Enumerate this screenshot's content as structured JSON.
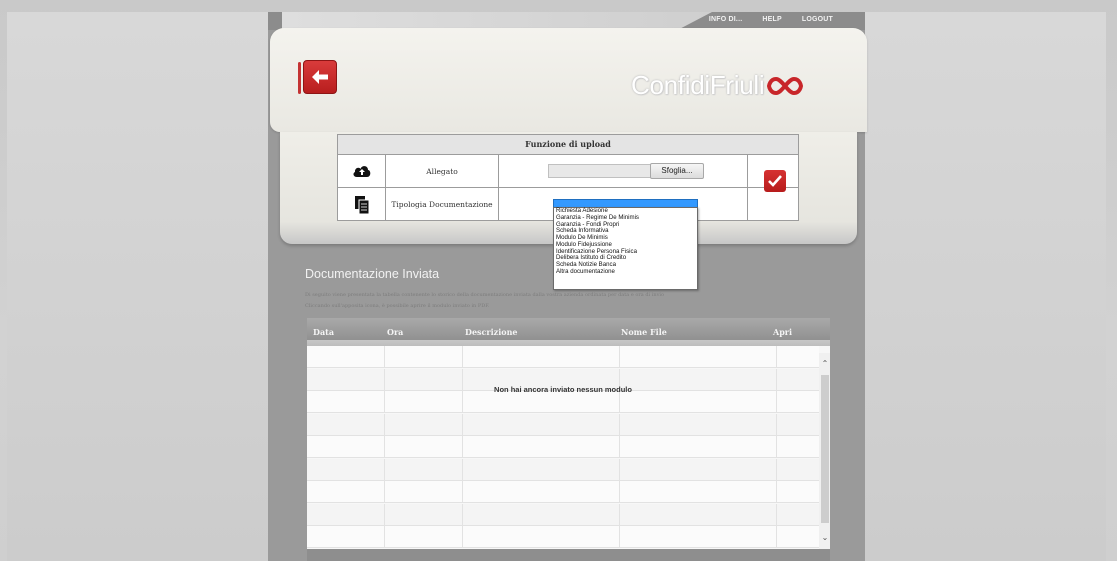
{
  "topnav": {
    "links": [
      "INFO DI...",
      "HELP",
      "LOGOUT"
    ]
  },
  "header": {
    "back_icon": "arrow-left-icon",
    "logo_text": "ConfidiFriuli",
    "logo_icon": "infinity-loop-icon",
    "brand_color": "#c8262a"
  },
  "upload": {
    "title": "Funzione di upload",
    "rows": [
      {
        "icon": "cloud-upload-icon",
        "label": "Allegato",
        "button": "Sfoglia..."
      },
      {
        "icon": "document-copy-icon",
        "label": "Tipologia Documentazione"
      }
    ],
    "confirm_icon": "checkmark-icon",
    "dropdown_options": [
      "Richiesta Adesione",
      "Garanzia - Regime De Minimis",
      "Garanzia - Fondi Propri",
      "Scheda Informativa",
      "Modulo De Minimis",
      "Modulo Fidejussione",
      "Identificazione Persona Fisica",
      "Delibera Istituto di Credito",
      "Scheda Notizie Banca",
      "Altra documentazione"
    ]
  },
  "documents": {
    "title": "Documentazione Inviata",
    "desc_line1": "Di seguito viene presentata la tabella contenente lo storico della documentazione inviata dalla vostra azienda ordinata per data e ora di invio",
    "desc_line2": "Cliccando sull'apposita icona, è possibile aprire il modulo inviato in PDF.",
    "columns": [
      "Data",
      "Ora",
      "Descrizione",
      "Nome File",
      "Apri"
    ],
    "empty_message": "Non hai ancora inviato nessun modulo"
  }
}
